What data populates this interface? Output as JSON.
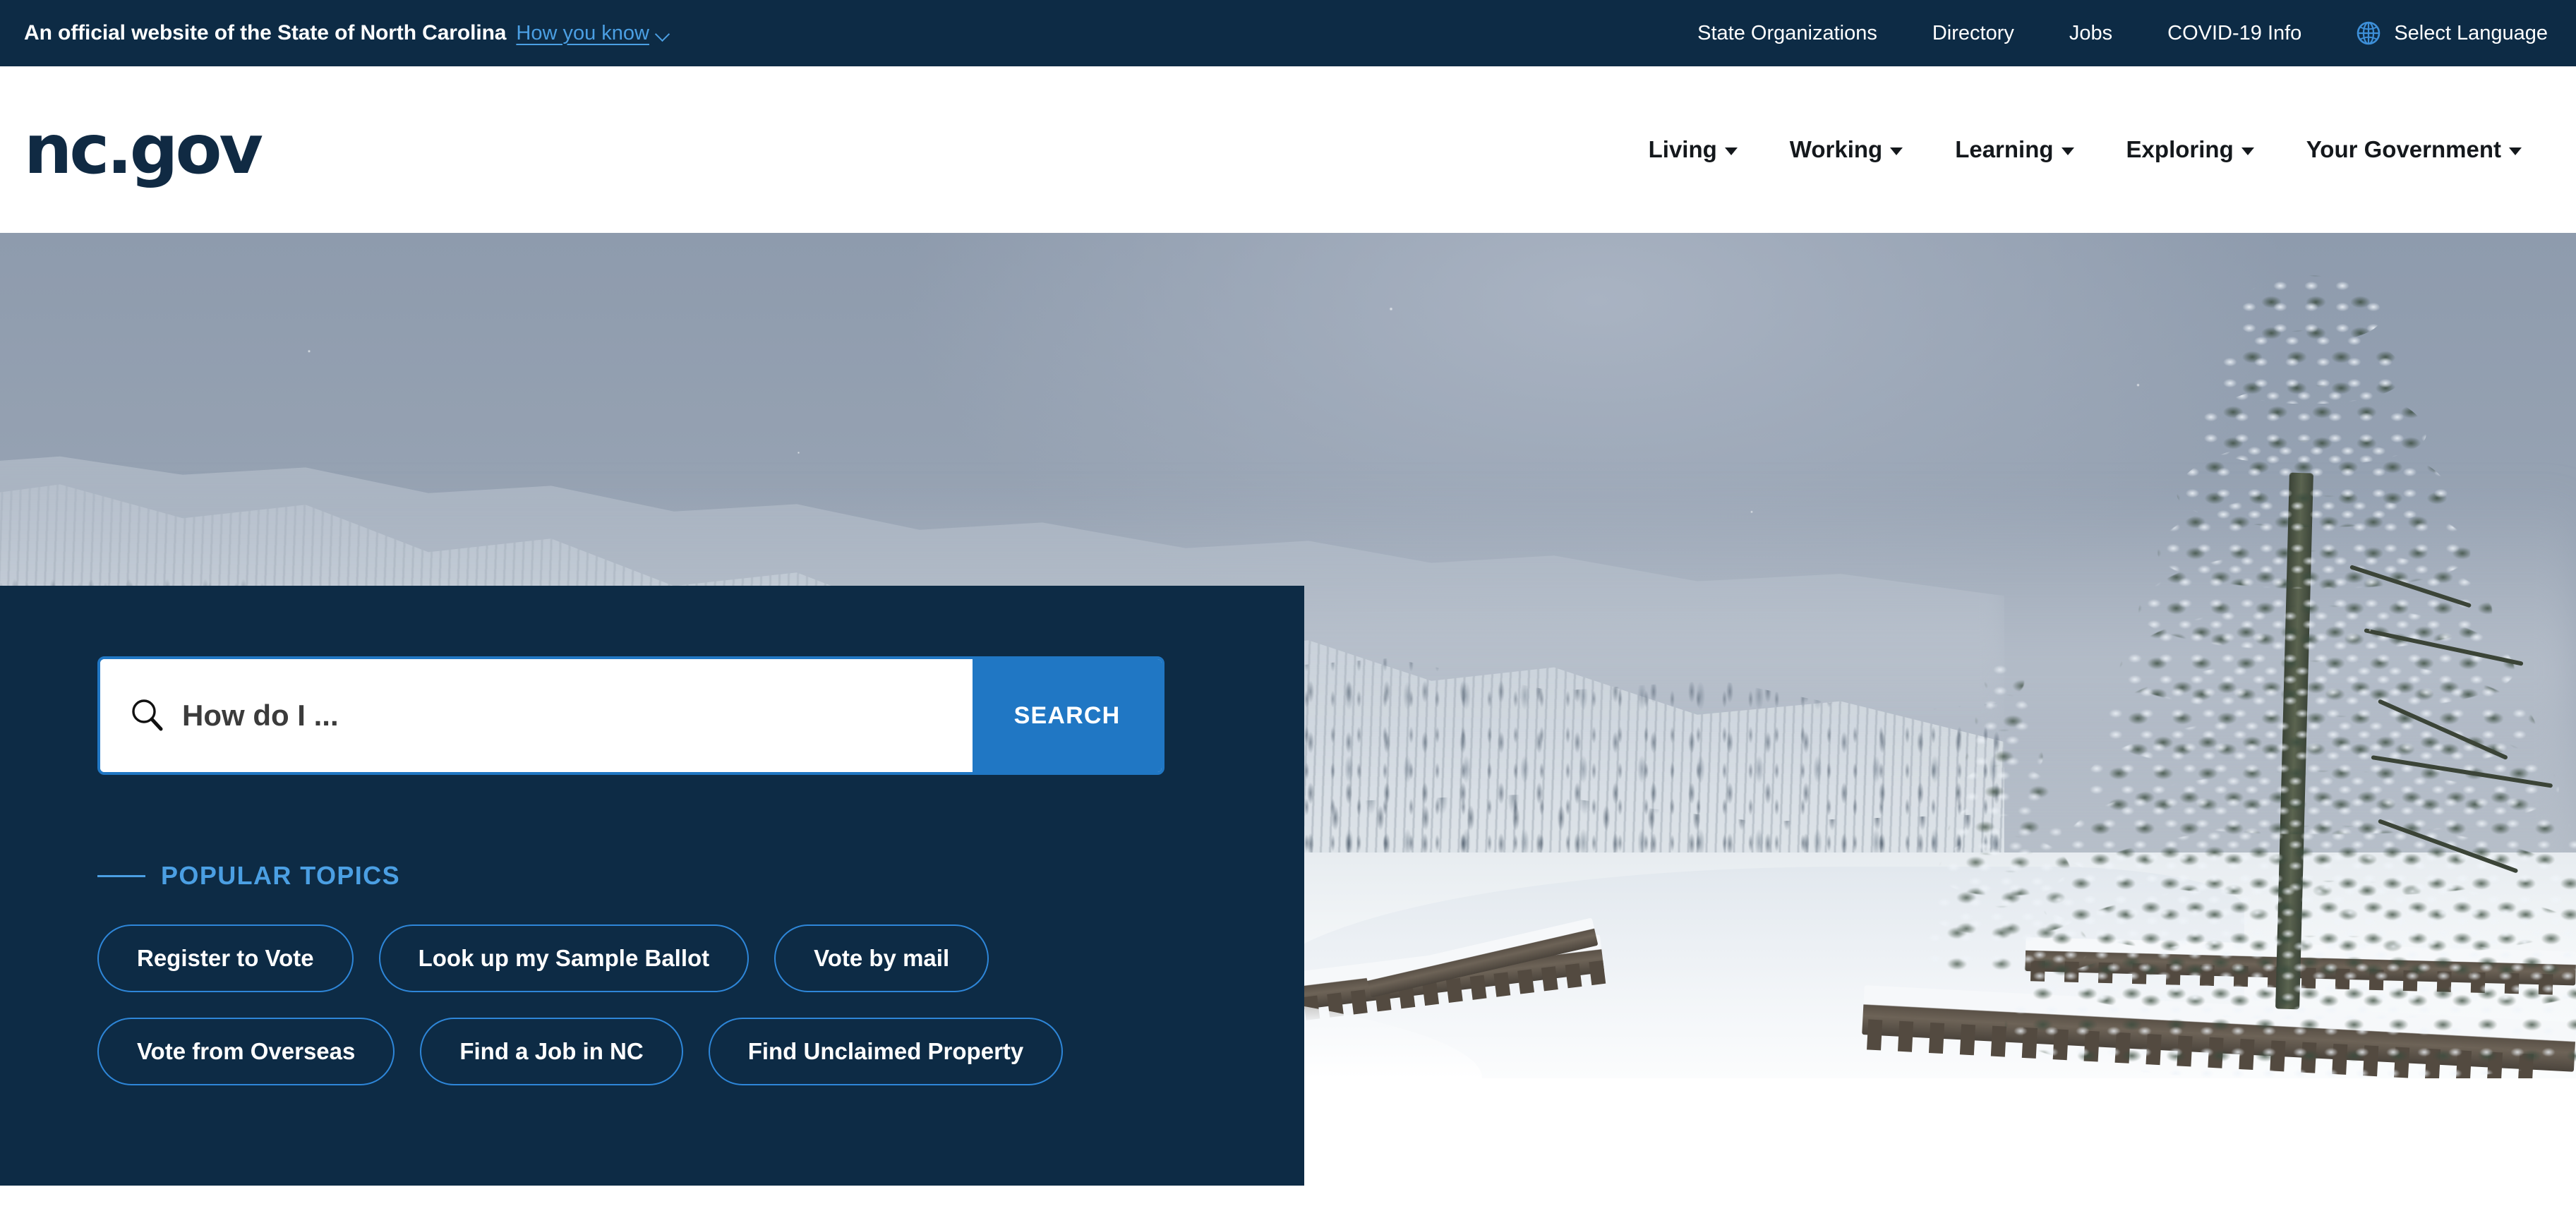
{
  "topbar": {
    "official_text": "An official website of the State of North Carolina",
    "how_you_know": "How you know",
    "how_you_know_icon": "chevron-down-icon",
    "links": [
      {
        "label": "State Organizations"
      },
      {
        "label": "Directory"
      },
      {
        "label": "Jobs"
      },
      {
        "label": "COVID-19 Info"
      }
    ],
    "language": {
      "icon": "globe-icon",
      "label": "Select Language"
    }
  },
  "header": {
    "logo": "nc.gov",
    "nav": [
      {
        "label": "Living",
        "icon": "caret-down-icon"
      },
      {
        "label": "Working",
        "icon": "caret-down-icon"
      },
      {
        "label": "Learning",
        "icon": "caret-down-icon"
      },
      {
        "label": "Exploring",
        "icon": "caret-down-icon"
      },
      {
        "label": "Your Government",
        "icon": "caret-down-icon"
      }
    ]
  },
  "hero": {
    "image_description": "Snow-covered forested mountainside with a snowy road and wooden guardrails, large snow-laden evergreen tree on the right, misty grey sky"
  },
  "search": {
    "icon": "search-icon",
    "placeholder": "How do I ...",
    "value": "",
    "button_label": "SEARCH"
  },
  "popular": {
    "title": "POPULAR TOPICS",
    "topics": [
      {
        "label": "Register to Vote"
      },
      {
        "label": "Look up my Sample Ballot"
      },
      {
        "label": "Vote by mail"
      },
      {
        "label": "Vote from Overseas"
      },
      {
        "label": "Find a Job in NC"
      },
      {
        "label": "Find Unclaimed Property"
      }
    ]
  },
  "colors": {
    "navy": "#0d2b45",
    "accent_blue": "#2077c4",
    "light_blue": "#4b9fe3",
    "pill_border": "#2e86d8",
    "logo_navy": "#102a43",
    "white": "#ffffff"
  }
}
